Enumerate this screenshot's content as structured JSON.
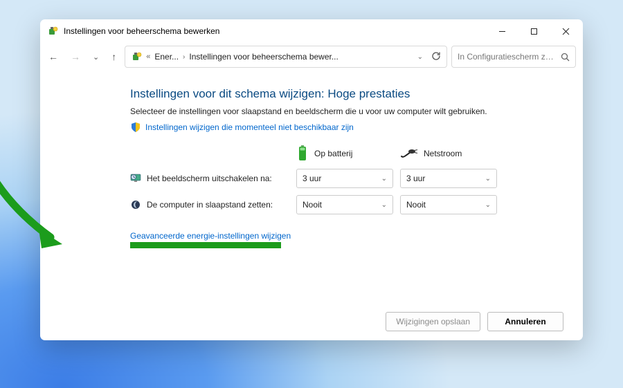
{
  "titlebar": {
    "title": "Instellingen voor beheerschema bewerken"
  },
  "address": {
    "crumb1": "Ener...",
    "crumb2": "Instellingen voor beheerschema bewer..."
  },
  "search": {
    "placeholder": "In Configuratiescherm zoek..."
  },
  "main": {
    "heading": "Instellingen voor dit schema wijzigen: Hoge prestaties",
    "subtext": "Selecteer de instellingen voor slaapstand en beeldscherm die u voor uw computer wilt gebruiken.",
    "unavailable_link": "Instellingen wijzigen die momenteel niet beschikbaar zijn",
    "col_battery": "Op batterij",
    "col_plugged": "Netstroom",
    "row_display": "Het beeldscherm uitschakelen na:",
    "row_sleep": "De computer in slaapstand zetten:",
    "display_battery": "3 uur",
    "display_plugged": "3 uur",
    "sleep_battery": "Nooit",
    "sleep_plugged": "Nooit",
    "advanced_link": "Geavanceerde energie-instellingen wijzigen"
  },
  "footer": {
    "save": "Wijzigingen opslaan",
    "cancel": "Annuleren"
  }
}
